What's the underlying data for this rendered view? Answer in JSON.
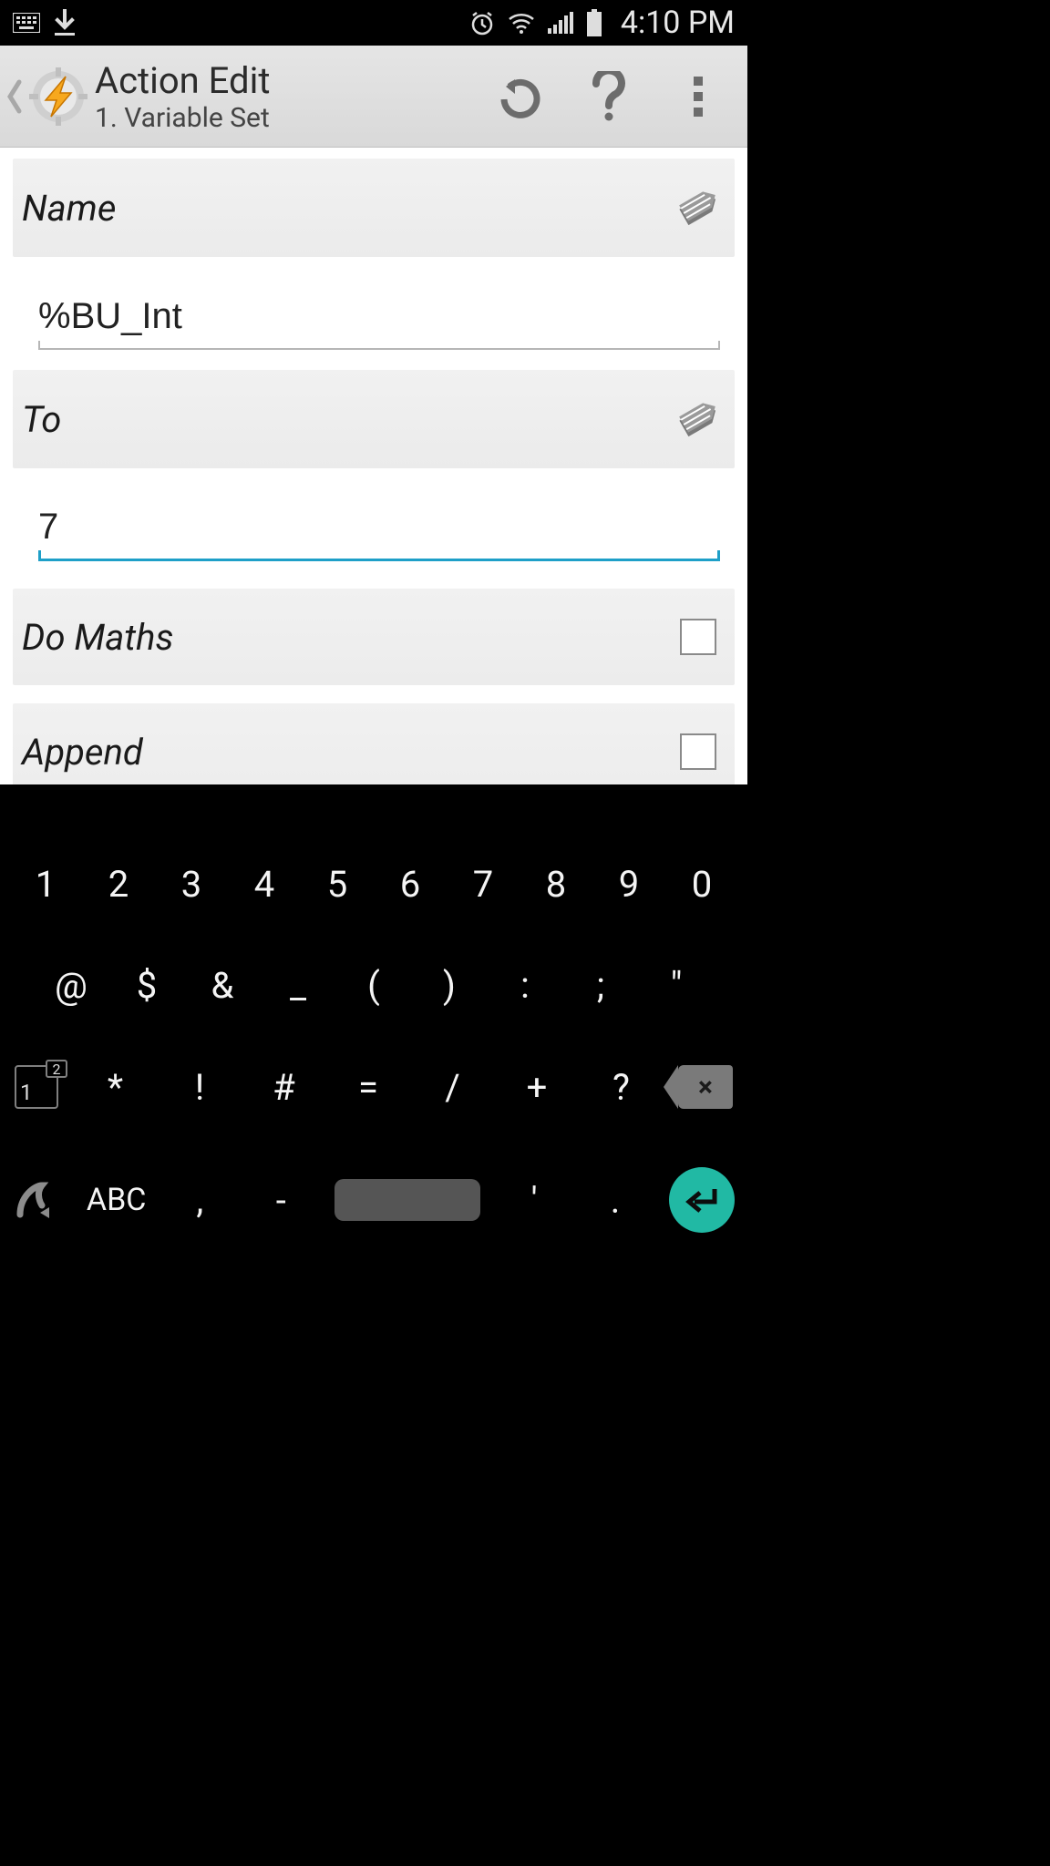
{
  "status_bar": {
    "time": "4:10 PM"
  },
  "header": {
    "title": "Action Edit",
    "subtitle": "1. Variable Set"
  },
  "sections": {
    "name": {
      "label": "Name",
      "value": "%BU_Int"
    },
    "to": {
      "label": "To",
      "value": "7"
    },
    "do_maths": {
      "label": "Do Maths",
      "checked": false
    },
    "append": {
      "label": "Append",
      "checked": false
    }
  },
  "keyboard": {
    "row1": [
      "1",
      "2",
      "3",
      "4",
      "5",
      "6",
      "7",
      "8",
      "9",
      "0"
    ],
    "row2": [
      "@",
      "$",
      "&",
      "_",
      "(",
      ")",
      ":",
      ";",
      "\""
    ],
    "row3": {
      "mode_main": "1",
      "mode_super": "2",
      "keys": [
        "*",
        "!",
        "#",
        "=",
        "/",
        "+",
        "?"
      ],
      "backspace": "×"
    },
    "row4": {
      "abc": "ABC",
      "comma": ",",
      "dash": "-",
      "apostrophe": "'",
      "period": "."
    }
  }
}
